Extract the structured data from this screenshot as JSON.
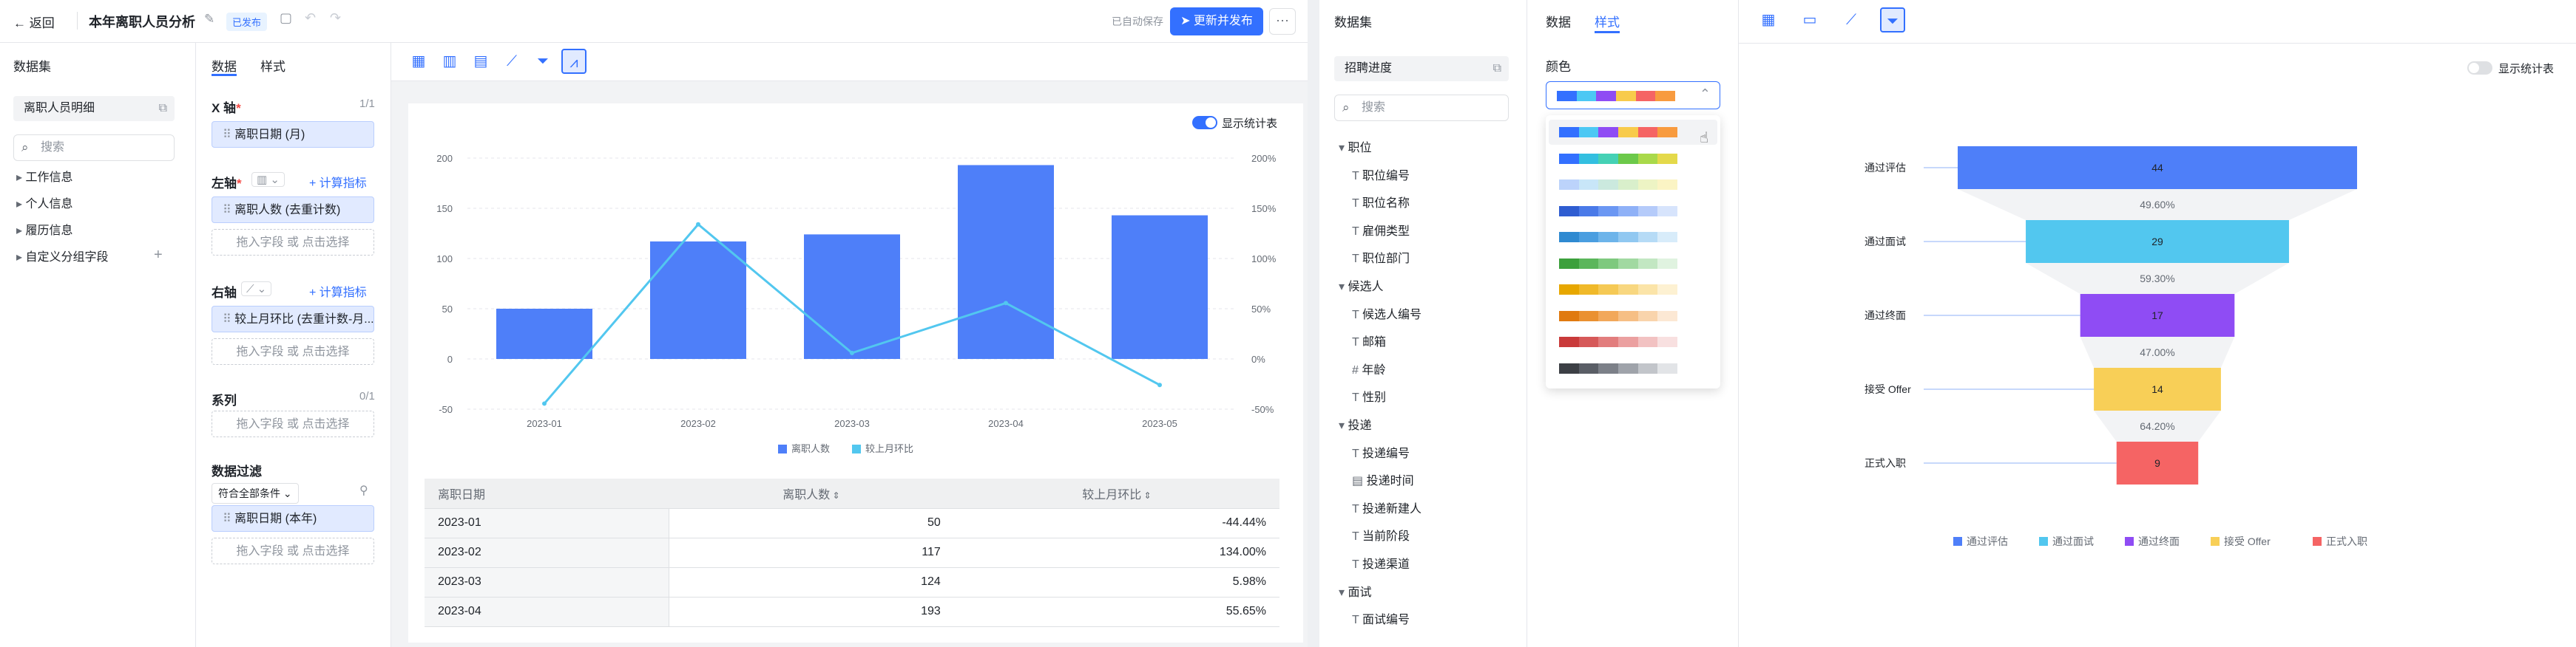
{
  "left": {
    "header": {
      "back": "返回",
      "title": "本年离职人员分析",
      "status_badge": "已发布",
      "autosave": "已自动保存",
      "publish": "更新并发布",
      "more": "···"
    },
    "dataset_panel": {
      "title": "数据集",
      "dataset_name": "离职人员明细",
      "search_placeholder": "搜索",
      "groups": [
        "工作信息",
        "个人信息",
        "履历信息",
        "自定义分组字段"
      ]
    },
    "config": {
      "tabs": [
        "数据",
        "样式"
      ],
      "x_axis_label": "X 轴",
      "x_axis_count": "1/1",
      "x_field": "离职日期 (月)",
      "left_axis_label": "左轴",
      "calc_metric": "计算指标",
      "left_field": "离职人数 (去重计数)",
      "drag_hint": "拖入字段 或 点击选择",
      "right_axis_label": "右轴",
      "right_field": "较上月环比 (去重计数-月...",
      "series_label": "系列",
      "series_count": "0/1",
      "filter_label": "数据过滤",
      "filter_condition": "符合全部条件",
      "filter_field": "离职日期 (本年)"
    },
    "chart_toolbar": [
      "table-icon",
      "bar-chart-icon",
      "grouped-bar-icon",
      "line-chart-icon",
      "funnel-icon",
      "combo-chart-icon"
    ],
    "show_stats": "显示统计表",
    "table": {
      "headers": [
        "离职日期",
        "离职人数",
        "较上月环比"
      ],
      "rows": [
        [
          "2023-01",
          "50",
          "-44.44%"
        ],
        [
          "2023-02",
          "117",
          "134.00%"
        ],
        [
          "2023-03",
          "124",
          "5.98%"
        ],
        [
          "2023-04",
          "193",
          "55.65%"
        ]
      ]
    },
    "colors": {
      "bar": "#4e7ff9",
      "line": "#52c7ef"
    }
  },
  "right": {
    "dataset_panel": {
      "title": "数据集",
      "dataset_name": "招聘进度",
      "search_placeholder": "搜索",
      "tree": [
        {
          "type": "group",
          "label": "职位"
        },
        {
          "type": "text",
          "label": "职位编号"
        },
        {
          "type": "text",
          "label": "职位名称"
        },
        {
          "type": "text",
          "label": "雇佣类型"
        },
        {
          "type": "text",
          "label": "职位部门"
        },
        {
          "type": "group",
          "label": "候选人"
        },
        {
          "type": "text",
          "label": "候选人编号"
        },
        {
          "type": "text",
          "label": "邮箱"
        },
        {
          "type": "number",
          "label": "年龄"
        },
        {
          "type": "text",
          "label": "性别"
        },
        {
          "type": "group",
          "label": "投递"
        },
        {
          "type": "text",
          "label": "投递编号"
        },
        {
          "type": "date",
          "label": "投递时间"
        },
        {
          "type": "text",
          "label": "投递新建人"
        },
        {
          "type": "text",
          "label": "当前阶段"
        },
        {
          "type": "text",
          "label": "投递渠道"
        },
        {
          "type": "group",
          "label": "面试"
        },
        {
          "type": "text",
          "label": "面试编号"
        }
      ]
    },
    "config": {
      "tabs": [
        "数据",
        "样式"
      ],
      "color_label": "颜色"
    },
    "palettes": [
      [
        "#3370ff",
        "#4cc8f4",
        "#8f4cf4",
        "#f8cb4b",
        "#f56464",
        "#f89b3f"
      ],
      [
        "#3370ff",
        "#33bfe0",
        "#45d1b5",
        "#6cc94a",
        "#a9d94a",
        "#e4d94a"
      ],
      [
        "#bcd3fb",
        "#c8e6f8",
        "#cbe9de",
        "#d9efcb",
        "#edf4c4",
        "#fbf4c4"
      ],
      [
        "#2f5dd1",
        "#4a7ae8",
        "#6b97f3",
        "#8fb1f7",
        "#b5cbfa",
        "#d7e4fc"
      ],
      [
        "#2f8ad1",
        "#4a9ee0",
        "#6db4ea",
        "#91c8f1",
        "#b6dbf6",
        "#d8ecfa"
      ],
      [
        "#3ca03c",
        "#5bb65b",
        "#7ec97e",
        "#a1d9a1",
        "#c2e7c2",
        "#e0f3e0"
      ],
      [
        "#e7a700",
        "#f0b92a",
        "#f5c955",
        "#f8d780",
        "#fbe4a8",
        "#fdf1d2"
      ],
      [
        "#e07a10",
        "#ea9131",
        "#f2a85a",
        "#f6bf85",
        "#f9d4ac",
        "#fce8d4"
      ],
      [
        "#c93a3a",
        "#d65959",
        "#e27d7d",
        "#eba0a0",
        "#f2c2c2",
        "#f8e0e0"
      ],
      [
        "#3c3f45",
        "#5a5e66",
        "#7c8088",
        "#9fa3aa",
        "#c2c5ca",
        "#e2e4e7"
      ]
    ],
    "chart_toolbar": [
      "table-icon",
      "card-icon",
      "line-chart-icon",
      "funnel-icon"
    ],
    "show_stats": "显示统计表"
  },
  "chart_data": [
    {
      "type": "bar",
      "categories": [
        "2023-01",
        "2023-02",
        "2023-03",
        "2023-04",
        "2023-05"
      ],
      "series": [
        {
          "name": "离职人数",
          "type": "bar",
          "axis": "left",
          "values": [
            50,
            117,
            124,
            193,
            143
          ]
        },
        {
          "name": "较上月环比",
          "type": "line",
          "axis": "right",
          "values": [
            -44.44,
            134.0,
            5.98,
            55.65,
            -25.9
          ]
        }
      ],
      "ylim_left": [
        -50,
        200
      ],
      "yticks_left": [
        "200",
        "150",
        "100",
        "50",
        "0",
        "-50"
      ],
      "ylim_right": [
        -50,
        200
      ],
      "yticks_right": [
        "200%",
        "150%",
        "100%",
        "50%",
        "0%",
        "-50%"
      ],
      "legend": "bottom",
      "grid": true
    },
    {
      "type": "funnel",
      "categories": [
        "通过评估",
        "通过面试",
        "通过终面",
        "接受 Offer",
        "正式入职"
      ],
      "values": [
        44,
        29,
        17,
        14,
        9
      ],
      "conversion": [
        "49.60%",
        "59.30%",
        "47.00%",
        "64.20%"
      ],
      "colors": [
        "#4e7ff9",
        "#52c7ef",
        "#8f4cf4",
        "#f8cf57",
        "#f56464"
      ],
      "legend": "bottom"
    }
  ]
}
